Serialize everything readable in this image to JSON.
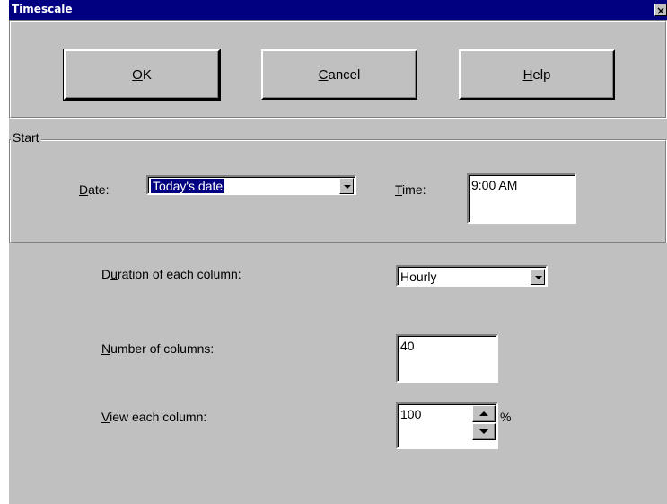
{
  "window": {
    "title": "Timescale",
    "close_glyph": "×"
  },
  "buttons": {
    "ok": {
      "mnemonic": "O",
      "rest": "K"
    },
    "cancel": {
      "mnemonic": "C",
      "rest": "ancel"
    },
    "help": {
      "mnemonic": "H",
      "rest": "elp"
    }
  },
  "start_group": {
    "label": "Start",
    "date": {
      "label_mnemonic": "D",
      "label_rest": "ate:",
      "value": "Today's date"
    },
    "time": {
      "label_mnemonic": "T",
      "label_rest": "ime:",
      "value": "9:00 AM"
    }
  },
  "duration": {
    "label_pre": "D",
    "label_mnemonic": "u",
    "label_rest": "ration of each column:",
    "value": "Hourly"
  },
  "columns": {
    "label_mnemonic": "N",
    "label_rest": "umber of columns:",
    "value": "40"
  },
  "view": {
    "label_mnemonic": "V",
    "label_rest": "iew each column:",
    "value": "100",
    "unit": "%"
  },
  "colors": {
    "title_bar": "#000080",
    "face": "#c0c0c0",
    "selection": "#000080"
  }
}
